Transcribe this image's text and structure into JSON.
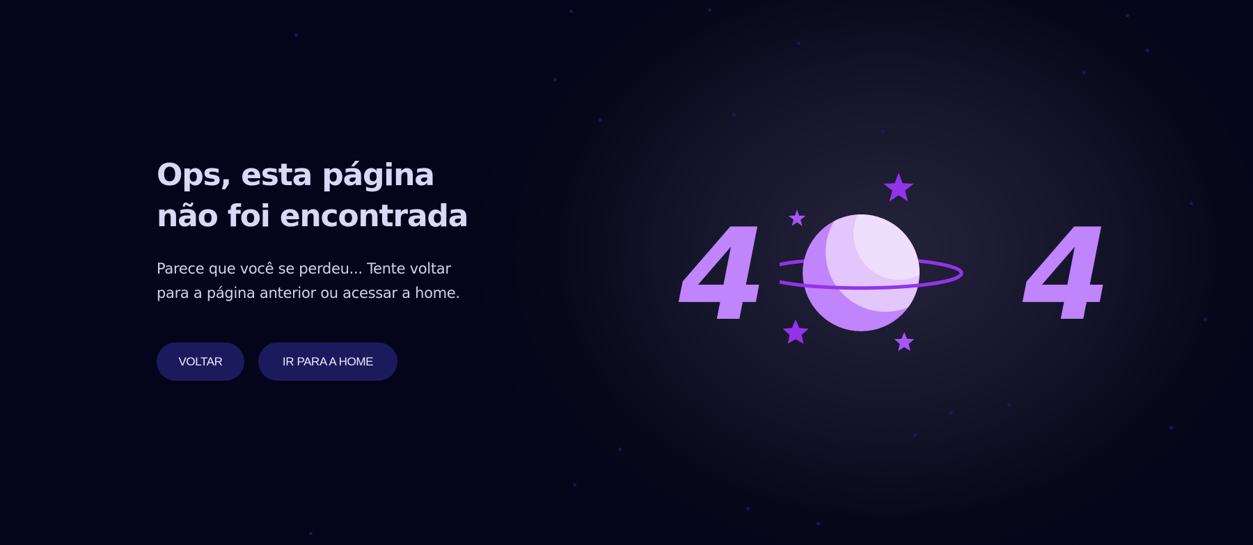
{
  "heading": {
    "line1": "Ops, esta página",
    "line2": "não foi encontrada"
  },
  "description": {
    "line1": "Parece que você se perdeu... Tente voltar",
    "line2": "para a página anterior ou acessar a home."
  },
  "buttons": {
    "back_label": "VOLTAR",
    "home_label": "IR PARA A HOME"
  },
  "illustration": {
    "digit_left": "4",
    "digit_right": "4",
    "center_icon": "planet-icon"
  },
  "colors": {
    "background": "#050518",
    "heading": "#d9d8f5",
    "button_bg": "#1b1a5c",
    "accent_purple": "#c084fc",
    "accent_violet": "#9333ea"
  }
}
